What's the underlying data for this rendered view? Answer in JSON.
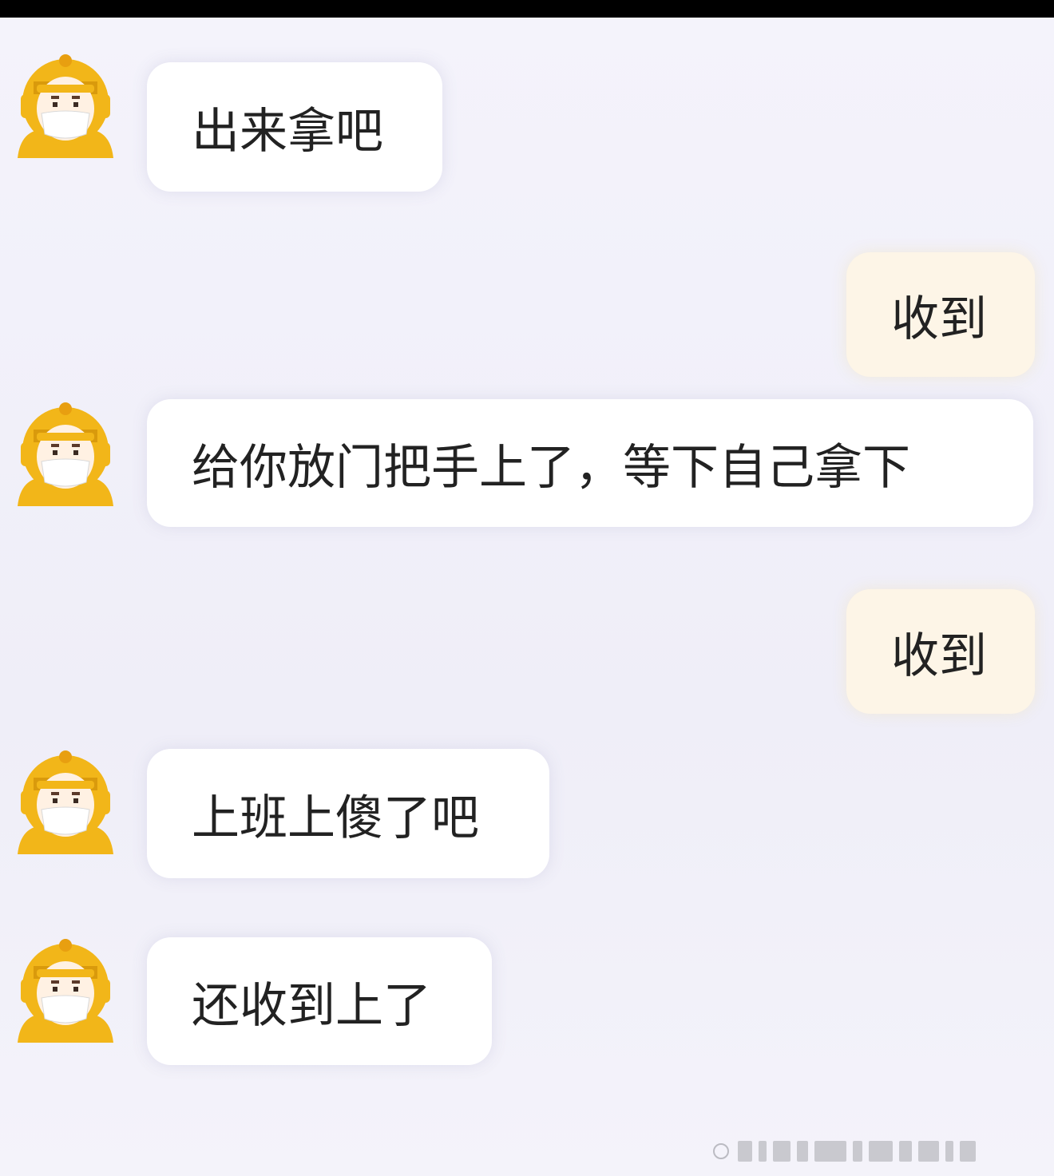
{
  "colors": {
    "background": "#f3f2fa",
    "incoming_bubble": "#ffffff",
    "outgoing_bubble": "#fdf5e7",
    "avatar_helmet": "#f2b619",
    "text": "#222222"
  },
  "messages": [
    {
      "direction": "incoming",
      "avatar_icon": "courier-avatar-icon",
      "text": "出来拿吧"
    },
    {
      "direction": "outgoing",
      "text": "收到"
    },
    {
      "direction": "incoming",
      "avatar_icon": "courier-avatar-icon",
      "text": "给你放门把手上了，等下自己拿下"
    },
    {
      "direction": "outgoing",
      "text": "收到"
    },
    {
      "direction": "incoming",
      "avatar_icon": "courier-avatar-icon",
      "text": "上班上傻了吧"
    },
    {
      "direction": "incoming",
      "avatar_icon": "courier-avatar-icon",
      "text": "还收到上了"
    }
  ]
}
